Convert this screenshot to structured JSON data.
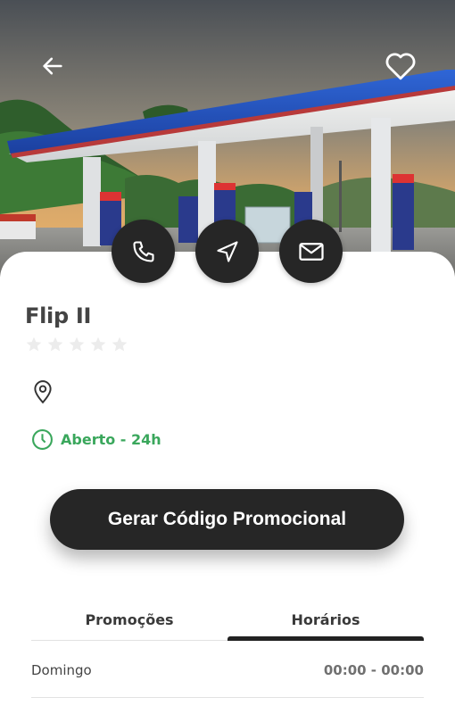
{
  "station": {
    "name": "Flip II",
    "rating_stars": 0,
    "rating_max": 5,
    "hours_status": "Aberto - 24h"
  },
  "icons": {
    "back": "arrow-left-icon",
    "favorite": "heart-icon",
    "phone": "phone-icon",
    "navigate": "navigation-icon",
    "email": "mail-icon",
    "location": "map-pin-icon",
    "clock": "clock-icon"
  },
  "promo_button": {
    "label": "Gerar Código Promocional"
  },
  "tabs": [
    {
      "label": "Promoções",
      "active": false
    },
    {
      "label": "Horários",
      "active": true
    }
  ],
  "schedule": [
    {
      "day": "Domingo",
      "hours": "00:00 - 00:00"
    }
  ],
  "colors": {
    "dark": "#262626",
    "open_green": "#3aa75c",
    "canopy_blue": "#1f4fb8"
  }
}
